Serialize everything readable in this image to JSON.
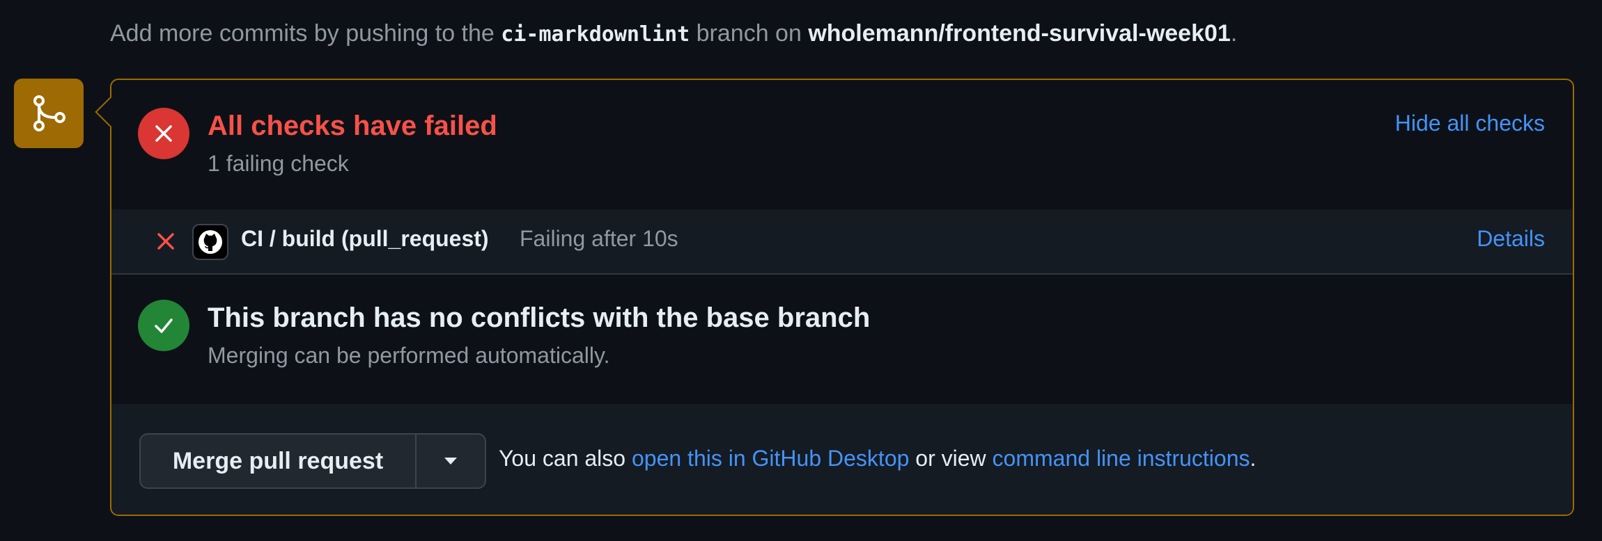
{
  "hint": {
    "prefix": "Add more commits by pushing to the ",
    "branch": "ci-markdownlint",
    "middle": " branch on ",
    "repo": "wholemann/frontend-survival-week01",
    "suffix": "."
  },
  "checks": {
    "title": "All checks have failed",
    "subtitle": "1 failing check",
    "toggle_label": "Hide all checks",
    "items": [
      {
        "name": "CI / build (pull_request)",
        "status": "Failing after 10s",
        "details_label": "Details"
      }
    ]
  },
  "conflicts": {
    "title": "This branch has no conflicts with the base branch",
    "subtitle": "Merging can be performed automatically."
  },
  "merge": {
    "button_label": "Merge pull request",
    "hint_prefix": "You can also ",
    "desktop_link": "open this in GitHub Desktop",
    "hint_middle": " or view ",
    "cli_link": "command line instructions",
    "hint_suffix": "."
  },
  "colors": {
    "fail": "#da3633",
    "success": "#238636",
    "accent_border": "#9e6a03",
    "link": "#4493f8"
  },
  "icons": {
    "badge": "git-merge-icon",
    "fail": "x-circle-icon",
    "success": "check-circle-icon",
    "check_fail": "x-icon",
    "check_avatar": "github-logo-icon",
    "caret": "triangle-down-icon"
  }
}
